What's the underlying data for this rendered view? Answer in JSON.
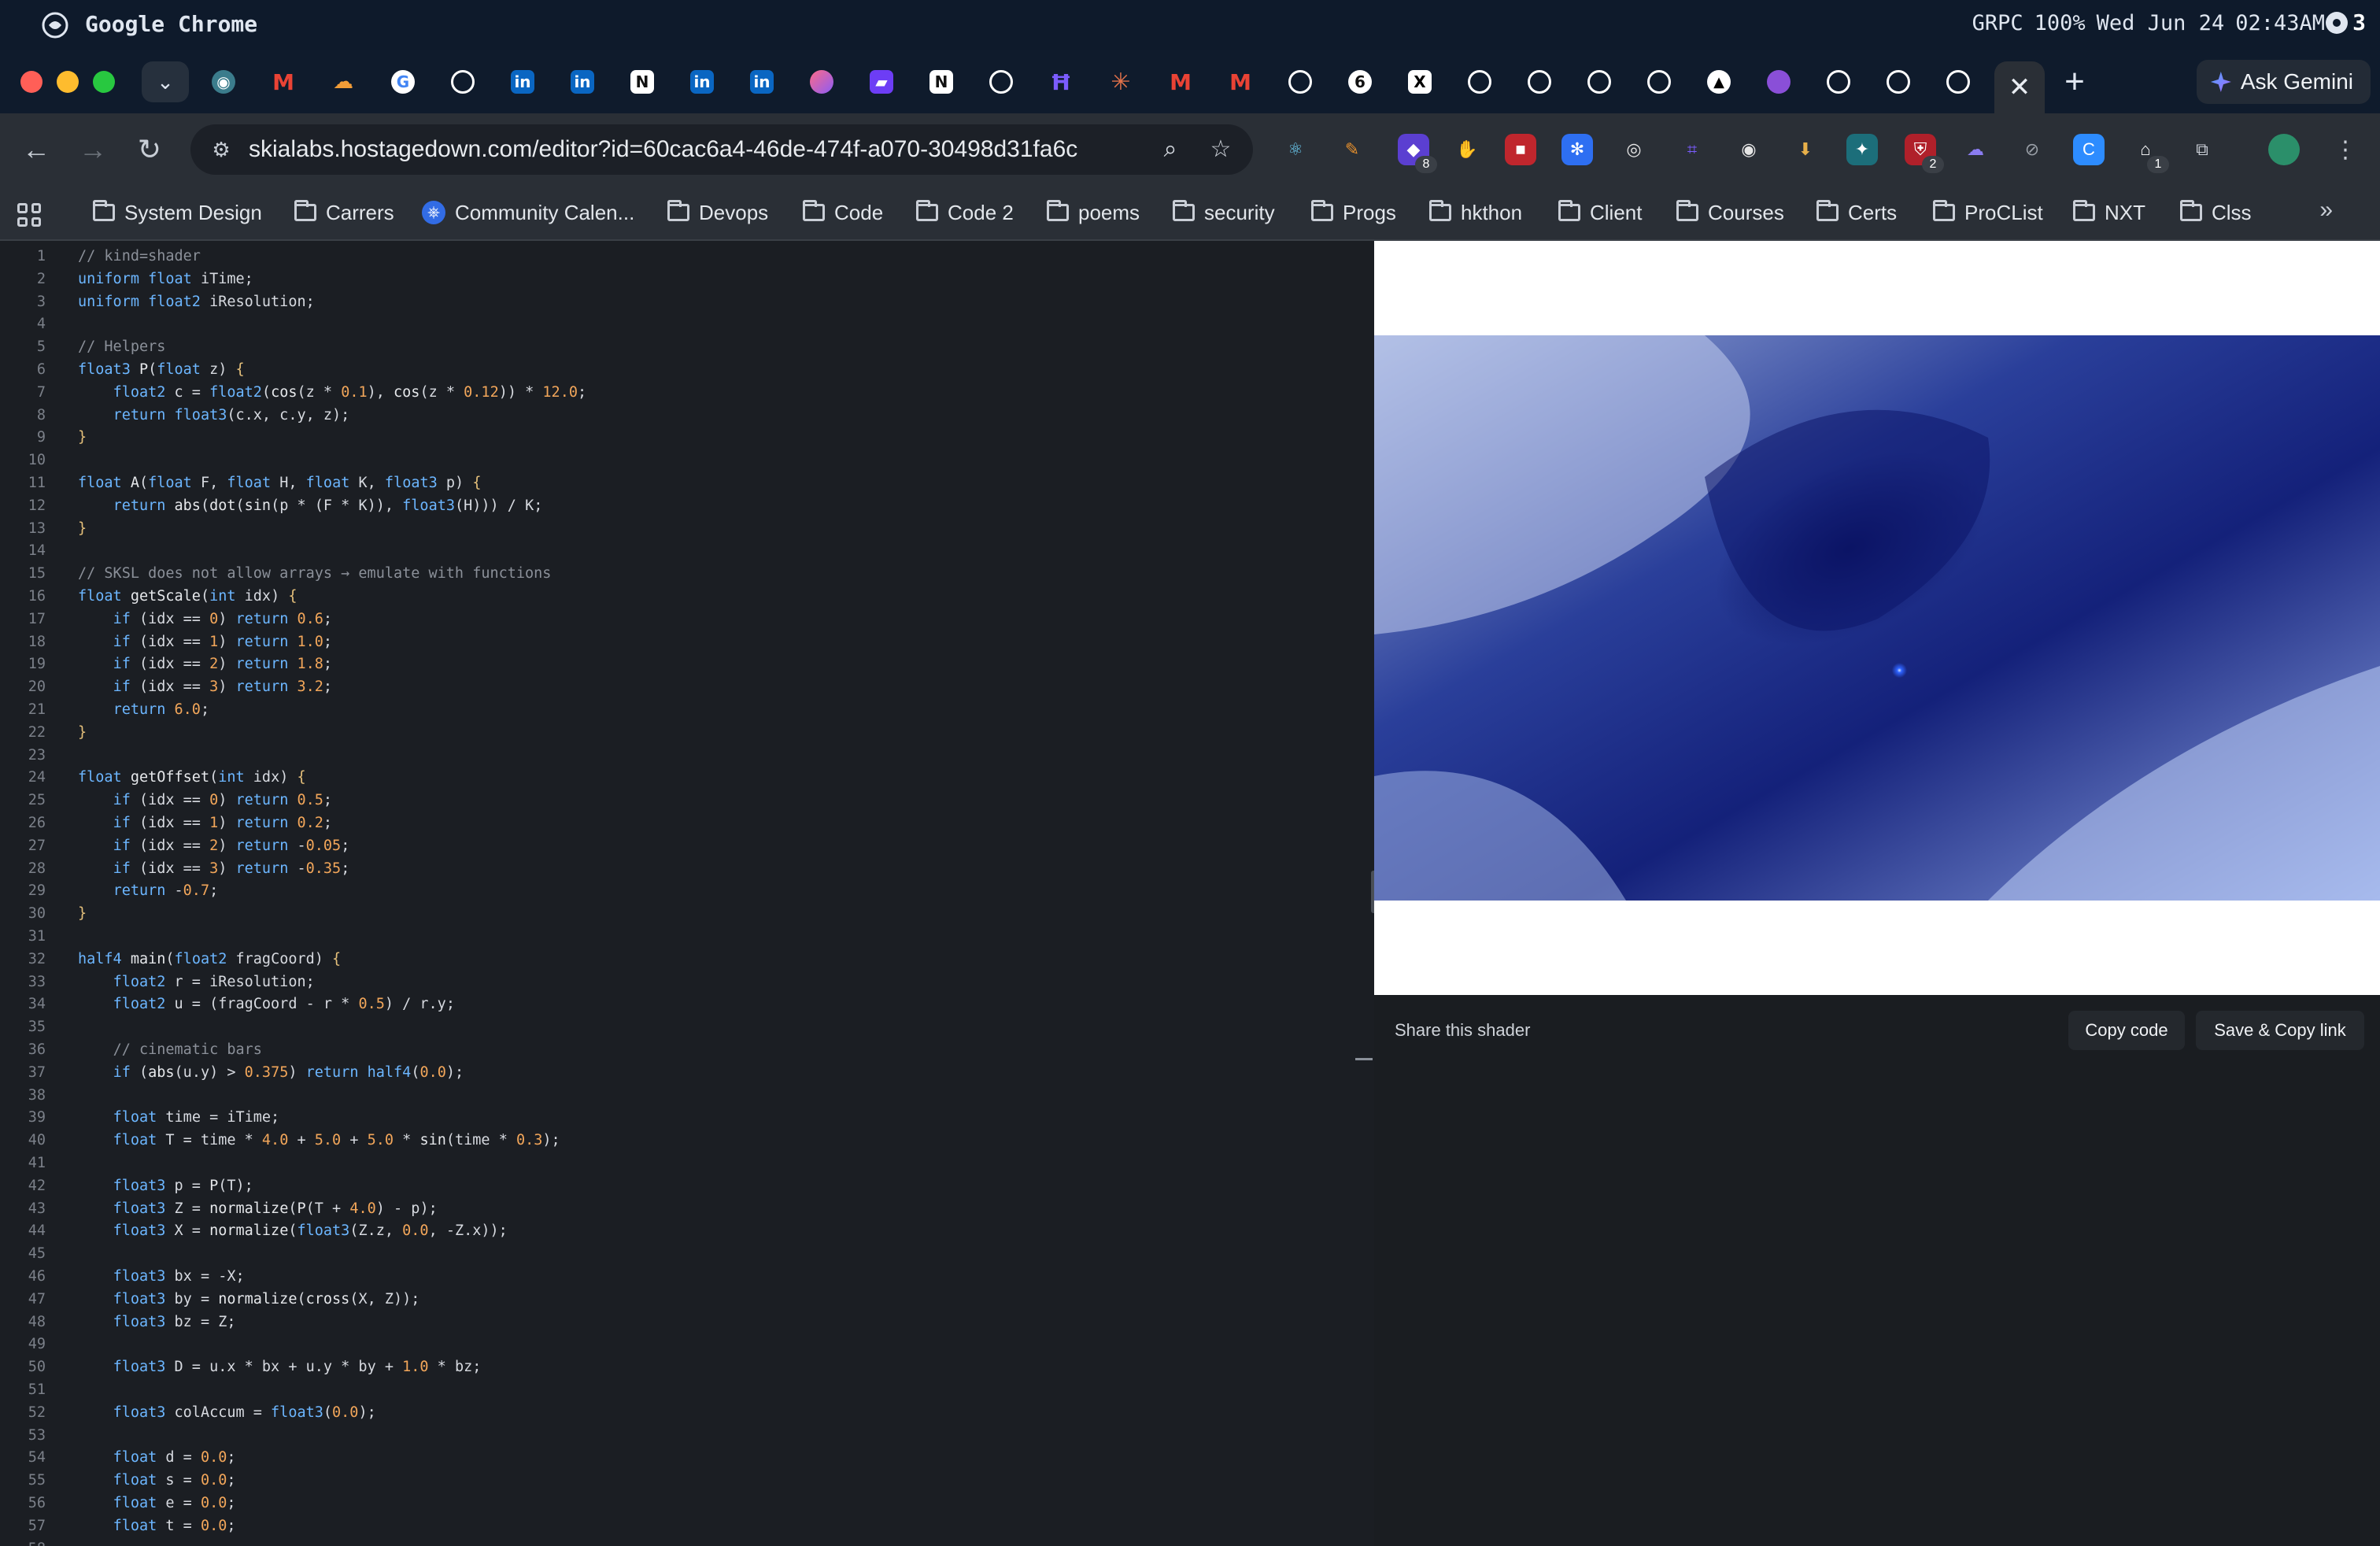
{
  "menubar": {
    "app_name": "Google Chrome",
    "status_items": [
      "GRPC",
      "100%",
      "Wed Jun 24",
      "02:43AM"
    ],
    "workspace": "3"
  },
  "tabs": {
    "favicons": [
      "incognito-mask",
      "gmail",
      "cloud",
      "google",
      "github",
      "linkedin",
      "linkedin",
      "notion",
      "linkedin",
      "linkedin",
      "app-pink",
      "app-purple",
      "notion",
      "openai",
      "app-violet",
      "claude",
      "gmail",
      "gmail",
      "github",
      "app-circle",
      "x",
      "github",
      "github",
      "github",
      "github",
      "vercel",
      "app-purple",
      "github",
      "github",
      "github"
    ],
    "active_close": "✕",
    "new_tab": "+",
    "ask_gemini": "Ask Gemini"
  },
  "toolbar": {
    "url": "skialabs.hostagedown.com/editor?id=60cac6a4-46de-474f-a070-30498d31fa6c",
    "extension_badges": {
      "ext3": "8",
      "ext11": "2",
      "ext16": "1"
    }
  },
  "bookmarks": [
    "System Design",
    "Carrers",
    "Community Calen...",
    "Devops",
    "Code",
    "Code 2",
    "poems",
    "security",
    "Progs",
    "hkthon",
    "Client",
    "Courses",
    "Certs",
    "ProCList",
    "NXT",
    "Clss"
  ],
  "editor": {
    "lines": [
      "// kind=shader",
      "uniform float iTime;",
      "uniform float2 iResolution;",
      "",
      "// Helpers",
      "float3 P(float z) {",
      "    float2 c = float2(cos(z * 0.1), cos(z * 0.12)) * 12.0;",
      "    return float3(c.x, c.y, z);",
      "}",
      "",
      "float A(float F, float H, float K, float3 p) {",
      "    return abs(dot(sin(p * (F * K)), float3(H))) / K;",
      "}",
      "",
      "// SKSL does not allow arrays → emulate with functions",
      "float getScale(int idx) {",
      "    if (idx == 0) return 0.6;",
      "    if (idx == 1) return 1.0;",
      "    if (idx == 2) return 1.8;",
      "    if (idx == 3) return 3.2;",
      "    return 6.0;",
      "}",
      "",
      "float getOffset(int idx) {",
      "    if (idx == 0) return 0.5;",
      "    if (idx == 1) return 0.2;",
      "    if (idx == 2) return -0.05;",
      "    if (idx == 3) return -0.35;",
      "    return -0.7;",
      "}",
      "",
      "half4 main(float2 fragCoord) {",
      "    float2 r = iResolution;",
      "    float2 u = (fragCoord - r * 0.5) / r.y;",
      "",
      "    // cinematic bars",
      "    if (abs(u.y) > 0.375) return half4(0.0);",
      "",
      "    float time = iTime;",
      "    float T = time * 4.0 + 5.0 + 5.0 * sin(time * 0.3);",
      "",
      "    float3 p = P(T);",
      "    float3 Z = normalize(P(T + 4.0) - p);",
      "    float3 X = normalize(float3(Z.z, 0.0, -Z.x));",
      "",
      "    float3 bx = -X;",
      "    float3 by = normalize(cross(X, Z));",
      "    float3 bz = Z;",
      "",
      "    float3 D = u.x * bx + u.y * by + 1.0 * bz;",
      "",
      "    float3 colAccum = float3(0.0);",
      "",
      "    float d = 0.0;",
      "    float s = 0.0;",
      "    float e = 0.0;",
      "    float t = 0.0;",
      ""
    ]
  },
  "preview": {
    "share_label": "Share this shader",
    "copy_code": "Copy code",
    "save_copy_link": "Save & Copy link"
  },
  "colors": {
    "keyword": "#6cb6ff",
    "number": "#f2a65a",
    "comment": "#8b9099",
    "brace": "#e5c07b",
    "type": "#6cb6ff"
  }
}
